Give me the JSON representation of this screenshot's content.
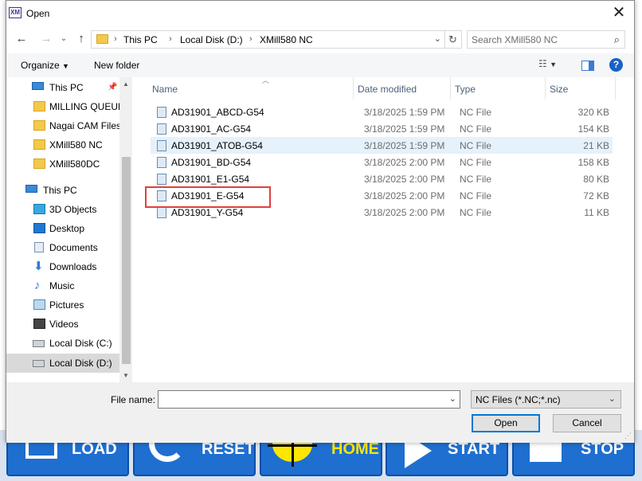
{
  "background_buttons": [
    {
      "label": "LOAD"
    },
    {
      "label": "RESET"
    },
    {
      "label": "HOME"
    },
    {
      "label": "START"
    },
    {
      "label": "STOP"
    }
  ],
  "dialog": {
    "app_icon_text": "XM",
    "title": "Open",
    "address": {
      "crumbs": [
        "This PC",
        "Local Disk (D:)",
        "XMill580 NC"
      ]
    },
    "search": {
      "placeholder": "Search XMill580 NC"
    },
    "toolbar": {
      "organize": "Organize",
      "new_folder": "New folder"
    },
    "nav_pane": {
      "items": [
        {
          "label": "This PC",
          "icon": "pc-icon"
        },
        {
          "label": "MILLING QUEUE",
          "icon": "folder-icon"
        },
        {
          "label": "Nagai CAM Files",
          "icon": "folder-icon"
        },
        {
          "label": "XMill580 NC",
          "icon": "folder-icon"
        },
        {
          "label": "XMill580DC",
          "icon": "folder-icon"
        },
        {
          "label": "This PC",
          "icon": "pc-icon"
        },
        {
          "label": "3D Objects",
          "icon": "3d-objects-icon"
        },
        {
          "label": "Desktop",
          "icon": "desktop-icon"
        },
        {
          "label": "Documents",
          "icon": "documents-icon"
        },
        {
          "label": "Downloads",
          "icon": "downloads-icon"
        },
        {
          "label": "Music",
          "icon": "music-icon"
        },
        {
          "label": "Pictures",
          "icon": "pictures-icon"
        },
        {
          "label": "Videos",
          "icon": "videos-icon"
        },
        {
          "label": "Local Disk (C:)",
          "icon": "disk-icon"
        },
        {
          "label": "Local Disk (D:)",
          "icon": "disk-icon"
        }
      ]
    },
    "columns": {
      "name": "Name",
      "date": "Date modified",
      "type": "Type",
      "size": "Size"
    },
    "files": [
      {
        "name": "AD31901_ABCD-G54",
        "date": "3/18/2025 1:59 PM",
        "type": "NC File",
        "size": "320 KB"
      },
      {
        "name": "AD31901_AC-G54",
        "date": "3/18/2025 1:59 PM",
        "type": "NC File",
        "size": "154 KB"
      },
      {
        "name": "AD31901_ATOB-G54",
        "date": "3/18/2025 1:59 PM",
        "type": "NC File",
        "size": "21 KB"
      },
      {
        "name": "AD31901_BD-G54",
        "date": "3/18/2025 2:00 PM",
        "type": "NC File",
        "size": "158 KB"
      },
      {
        "name": "AD31901_E1-G54",
        "date": "3/18/2025 2:00 PM",
        "type": "NC File",
        "size": "80 KB"
      },
      {
        "name": "AD31901_E-G54",
        "date": "3/18/2025 2:00 PM",
        "type": "NC File",
        "size": "72 KB"
      },
      {
        "name": "AD31901_Y-G54",
        "date": "3/18/2025 2:00 PM",
        "type": "NC File",
        "size": "11 KB"
      }
    ],
    "file_name": {
      "label": "File name:",
      "value": ""
    },
    "filter": {
      "selected": "NC Files (*.NC;*.nc)"
    },
    "buttons": {
      "open": "Open",
      "cancel": "Cancel"
    },
    "colors": {
      "accent": "#0078d7",
      "highlight": "#e0403a",
      "hover_row": "#e5f1fb"
    }
  }
}
